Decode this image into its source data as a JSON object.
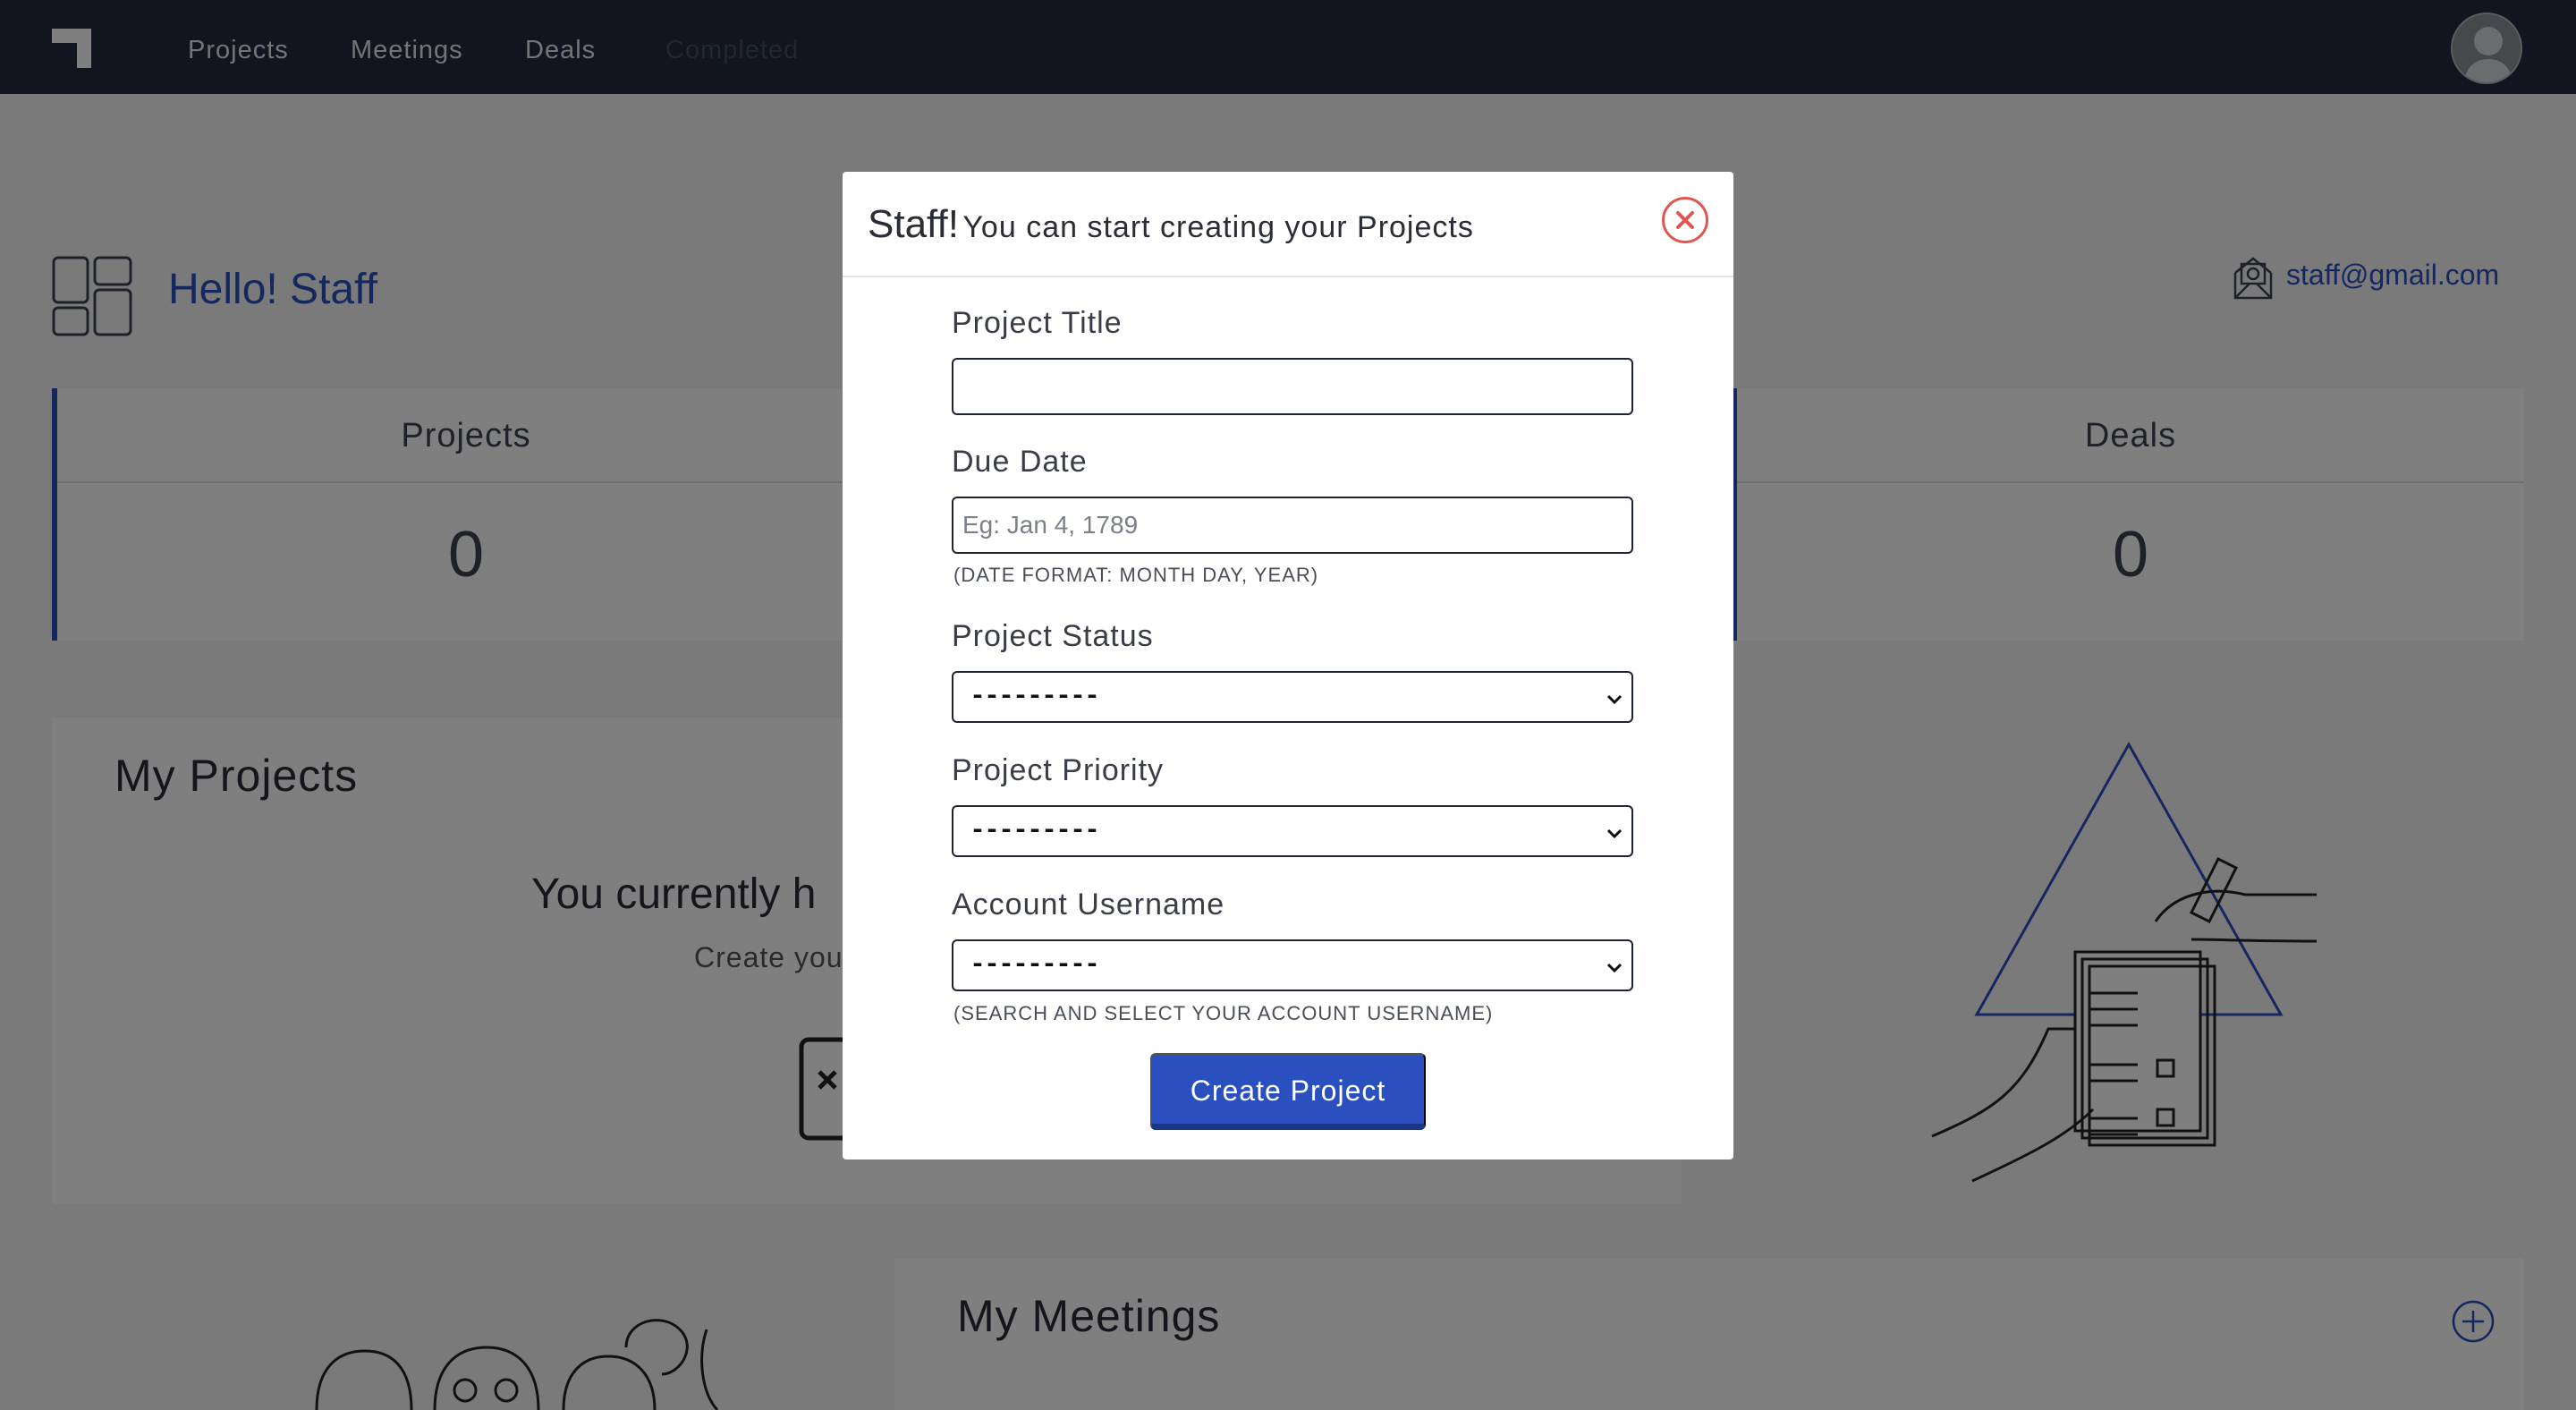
{
  "nav": {
    "links": [
      "Projects",
      "Meetings",
      "Deals",
      "Completed"
    ]
  },
  "dashboard": {
    "greeting": "Hello! Staff",
    "email": "staff@gmail.com",
    "stats": [
      {
        "label": "Projects",
        "value": "0"
      },
      {
        "label": "Deals",
        "value": "0"
      }
    ],
    "my_projects": {
      "title": "My Projects",
      "empty_heading": "You currently h",
      "empty_sub": "Create you"
    },
    "my_meetings": {
      "title": "My Meetings"
    }
  },
  "modal": {
    "title_strong": "Staff!",
    "title_rest": "You can start creating your Projects",
    "fields": {
      "project_title": {
        "label": "Project Title",
        "value": ""
      },
      "due_date": {
        "label": "Due Date",
        "placeholder": "Eg: Jan 4, 1789",
        "hint": "(DATE FORMAT: MONTH DAY, YEAR)"
      },
      "project_status": {
        "label": "Project Status",
        "selected": "---------"
      },
      "project_priority": {
        "label": "Project Priority",
        "selected": "---------"
      },
      "account_username": {
        "label": "Account Username",
        "selected": "---------",
        "hint": "(SEARCH AND SELECT YOUR ACCOUNT USERNAME)"
      }
    },
    "submit_label": "Create Project"
  },
  "colors": {
    "nav_bg": "#242a3f",
    "accent": "#2a4fbf",
    "close": "#e0564e",
    "overlay": "rgba(0,0,0,0.5)"
  },
  "icons": [
    "logo-icon",
    "avatar-icon",
    "dashboard-grid-icon",
    "email-icon",
    "close-icon",
    "chevron-down-icon",
    "add-meeting-icon"
  ]
}
